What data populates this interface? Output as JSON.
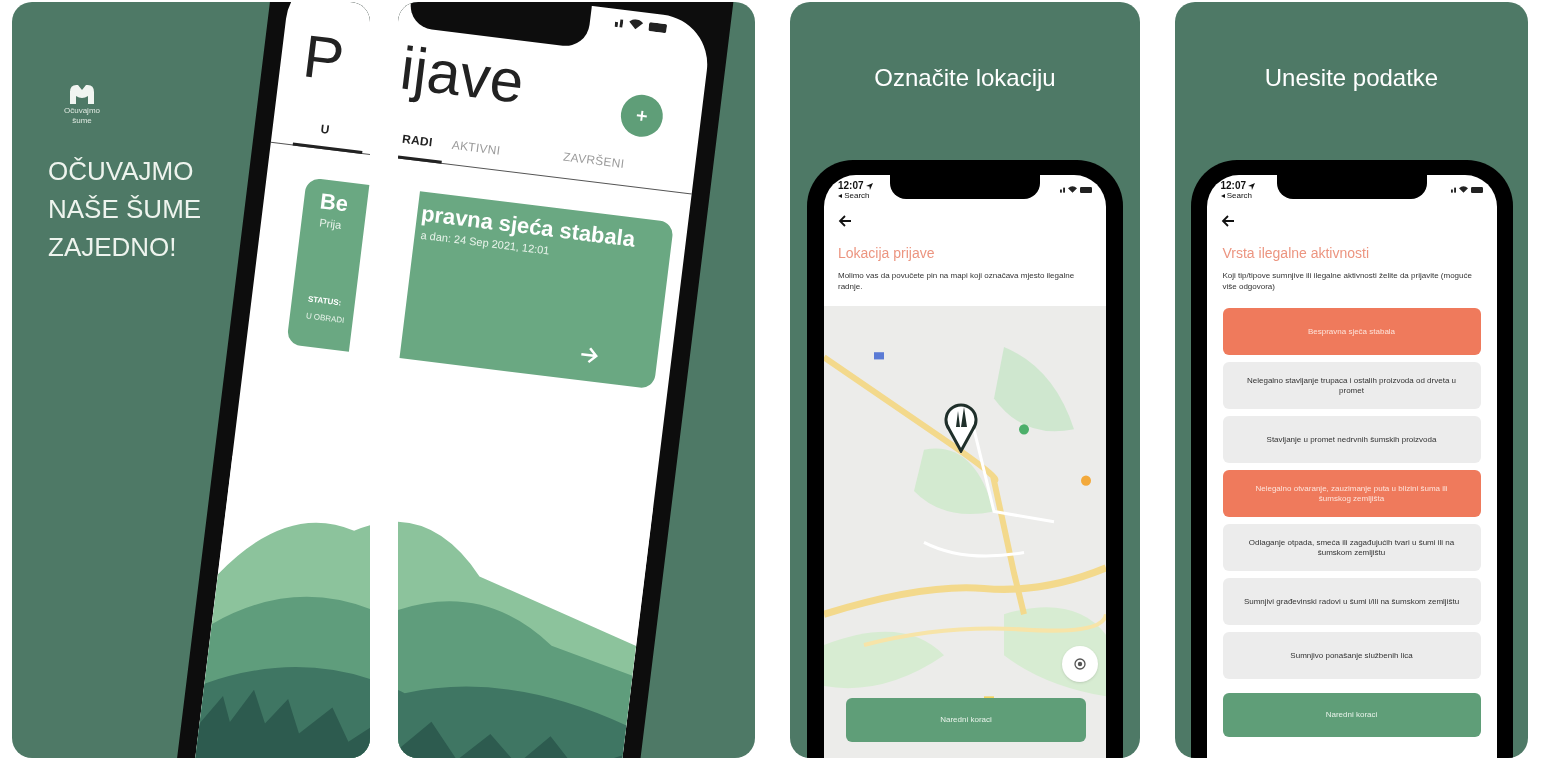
{
  "intro": {
    "logo_text": [
      "Očuvajmo",
      "šume"
    ],
    "tagline": [
      "OČUVAJMO",
      "NAŠE ŠUME",
      "ZAJEDNO!"
    ]
  },
  "reports_screen": {
    "title": {
      "left": "P",
      "right": "ijave"
    },
    "tabs": [
      {
        "left": "U",
        "right": "RADI",
        "selected": true
      },
      {
        "right": "AKTIVNI",
        "selected": false
      },
      {
        "right": "ZAVRŠENI",
        "selected": false
      }
    ],
    "card": {
      "title": {
        "left": "Be",
        "right": "pravna sjeća stabala"
      },
      "date": {
        "left": "Prija",
        "right": "a dan:  24 Sep 2021, 12:01"
      },
      "status_label": "STATUS:",
      "status_value": "U OBRADI"
    }
  },
  "location_screen": {
    "headline": "Označite lokaciju",
    "time": "12:07",
    "back_label": "◂ Search",
    "heading": "Lokacija prijave",
    "description": "Molimo vas da povučete pin na mapi koji označava mjesto ilegalne radnje.",
    "button": "Naredni koraci"
  },
  "details_screen": {
    "headline": "Unesite podatke",
    "time": "12:07",
    "back_label": "◂ Search",
    "heading": "Vrsta ilegalne aktivnosti",
    "description": "Koji tip/tipove sumnjive ili ilegalne aktivnosti želite da prijavite (moguće više odgovora)",
    "options": [
      {
        "label": "Bespravna sječa stabala",
        "selected": true
      },
      {
        "label": "Nelegalno stavljanje trupaca i ostalih proizvoda od drveta u promet",
        "selected": false
      },
      {
        "label": "Stavljanje u promet nedrvnih šumskih proizvoda",
        "selected": false
      },
      {
        "label": "Nelegalno otvaranje, zauzimanje puta u blizini šuma ili šumskog zemljišta",
        "selected": true
      },
      {
        "label": "Odlaganje otpada, smeća ili zagađujućih tvari u šumi ili na šumskom zemljištu",
        "selected": false
      },
      {
        "label": "Sumnjivi građevinski radovi u šumi i/ili na šumskom zemljištu",
        "selected": false
      },
      {
        "label": "Sumnjivo ponašanje službenih lica",
        "selected": false
      }
    ],
    "button": "Naredni koraci"
  }
}
